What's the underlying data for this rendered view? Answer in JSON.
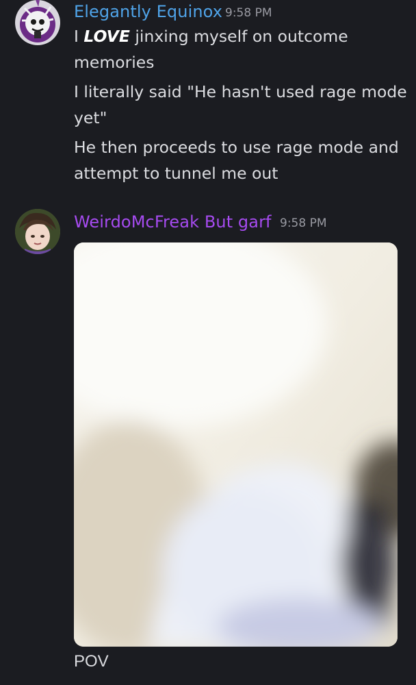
{
  "messages": [
    {
      "username": "Elegantly Equinox",
      "username_color": "#4fa3e8",
      "timestamp": "9:58 PM",
      "line1_prefix": "I ",
      "line1_emphasis": "LOVE",
      "line1_suffix": " jinxing myself on outcome",
      "line2": "memories",
      "line3": "I literally said \"He hasn't used rage mode",
      "line4": "yet\"",
      "line5": "He then proceeds to use rage mode and",
      "line6": "attempt to tunnel me out",
      "avatar_icon": "skull-avatar-icon"
    },
    {
      "username": "WeirdoMcFreak But garf",
      "username_color": "#a64bf0",
      "timestamp": "9:58 PM",
      "caption": "POV",
      "avatar_icon": "character-avatar-icon"
    }
  ],
  "colors": {
    "background": "#1b1c21",
    "text": "#dcdde1",
    "timestamp": "#9a9ba3"
  }
}
